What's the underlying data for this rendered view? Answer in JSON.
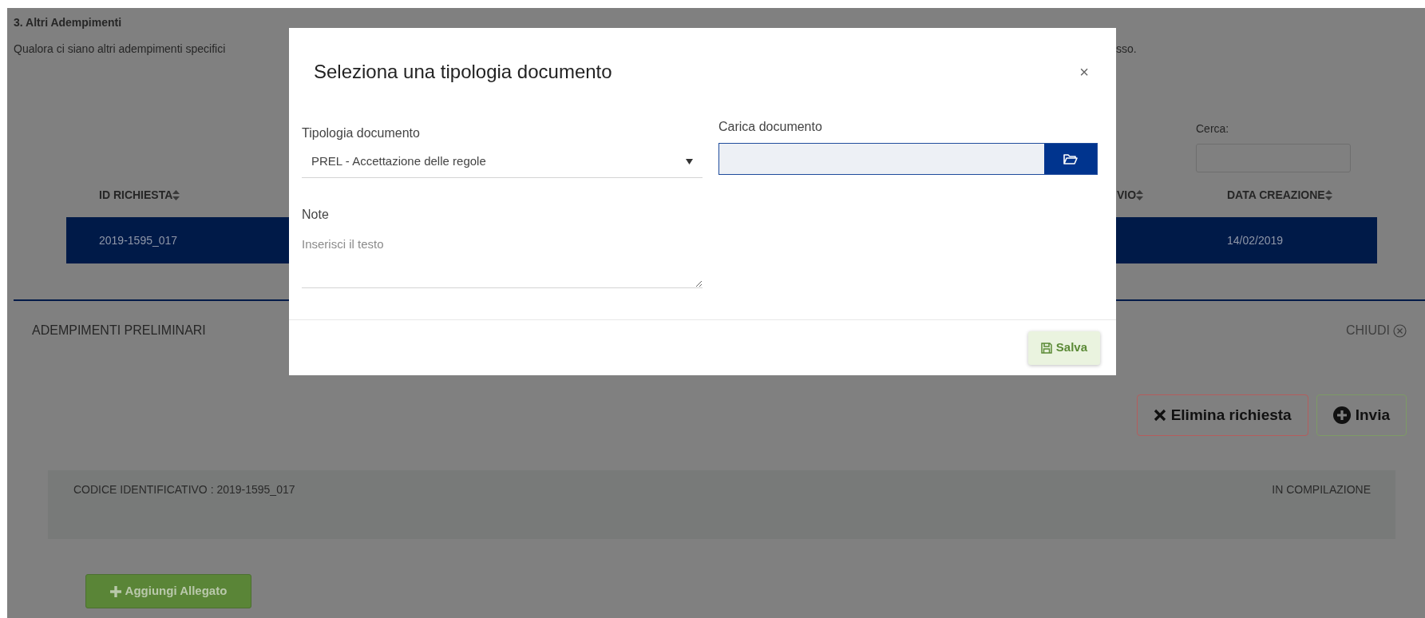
{
  "page": {
    "section_title": "3. Altri Adempimenti",
    "description": [
      "Qualora ci siano altri adempimenti specifici",
      "sso."
    ]
  },
  "search": {
    "label": "Cerca:"
  },
  "table": {
    "columns": [
      {
        "label": "ID RICHIESTA"
      },
      {
        "label": "VIO"
      },
      {
        "label": "DATA CREAZIONE"
      }
    ],
    "rows": [
      {
        "cells": [
          "2019-1595_017",
          "",
          "14/02/2019"
        ],
        "selected": true
      }
    ]
  },
  "panel": {
    "title": "ADEMPIMENTI PRELIMINARI",
    "close_label": "CHIUDI",
    "actions": [
      {
        "kind": "delete",
        "label": "Elimina richiesta"
      },
      {
        "kind": "send",
        "label": "Invia"
      }
    ],
    "code": "CODICE IDENTIFICATIVO : 2019-1595_017",
    "status": "IN COMPILAZIONE",
    "add_button": "Aggiungi Allegato"
  },
  "modal": {
    "title": "Seleziona una tipologia documento",
    "close": "×",
    "fields": [
      {
        "kind": "select",
        "label": "Tipologia documento",
        "value": "PREL - Accettazione delle regole"
      },
      {
        "kind": "file",
        "label": "Carica documento"
      },
      {
        "kind": "textarea",
        "label": "Note",
        "placeholder": "Inserisci il testo"
      }
    ],
    "save": "Salva"
  }
}
